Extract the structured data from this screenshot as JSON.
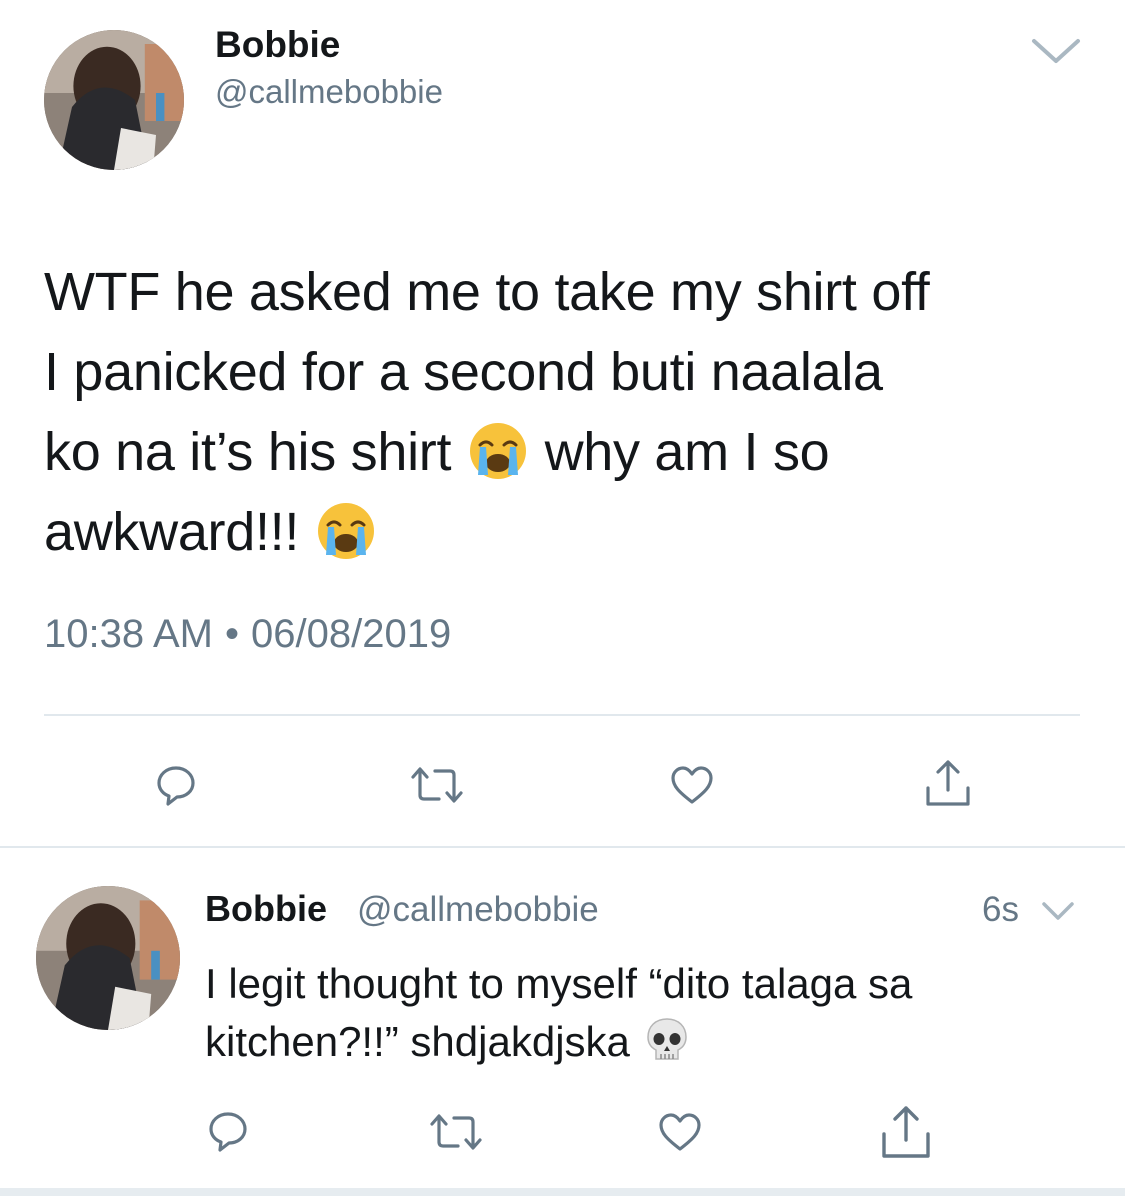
{
  "main_tweet": {
    "author_name": "Bobbie",
    "author_handle": "@callmebobbie",
    "text_lines": [
      "WTF he asked me to take my shirt off",
      "I panicked for a second buti naalala",
      "ko na it’s his shirt",
      "why am I so",
      "awkward!!!"
    ],
    "emoji": "loudly-crying-face",
    "time": "10:38 AM",
    "separator": "•",
    "date": "06/08/2019",
    "actions": [
      "reply-icon",
      "retweet-icon",
      "like-icon",
      "share-icon"
    ]
  },
  "reply_tweet": {
    "author_name": "Bobbie",
    "author_handle": "@callmebobbie",
    "time": "6s",
    "text_lines": [
      "I legit thought to myself “dito talaga sa",
      "kitchen?!!” shdjakdjska"
    ],
    "emoji": "skull",
    "actions": [
      "reply-icon",
      "retweet-icon",
      "like-icon",
      "share-icon"
    ]
  },
  "colors": {
    "text_primary": "#14171a",
    "text_secondary": "#657786",
    "divider": "#e1e8ed",
    "icon": "#657786"
  }
}
